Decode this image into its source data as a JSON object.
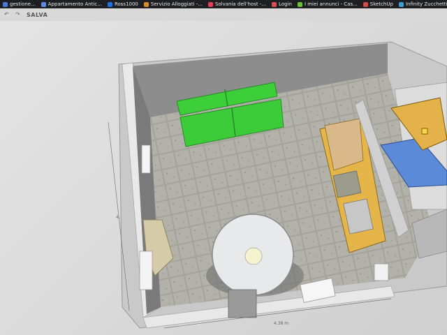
{
  "bookmarks": [
    {
      "label": "gestione...",
      "color": "#4a7bd0"
    },
    {
      "label": "Appartamento Antic...",
      "color": "#5b8def"
    },
    {
      "label": "Ross1000",
      "color": "#1f6fe0"
    },
    {
      "label": "Servizio Alloggiati -...",
      "color": "#d58b2f"
    },
    {
      "label": "Solvania dell'host -...",
      "color": "#e0405a"
    },
    {
      "label": "Login",
      "color": "#e24b4b"
    },
    {
      "label": "I miei annunci - Cas...",
      "color": "#6fbf3a"
    },
    {
      "label": "SketchUp",
      "color": "#d04a4a"
    },
    {
      "label": "Infinity Zucchetti",
      "color": "#3aa0d8"
    }
  ],
  "toolbar": {
    "undo_icon": "undo-icon",
    "redo_icon": "redo-icon",
    "save_label": "SALVA"
  },
  "plan": {
    "dim_bottom": "4.38 m",
    "dim_left": "4.",
    "colors": {
      "floor_tile": "#a8a8a0",
      "wall": "#bdbdbd",
      "bench": "#3cc93c",
      "kitchen": "#e6b54a",
      "shower": "#4f7fd6",
      "table": "#e7e9ea"
    }
  }
}
